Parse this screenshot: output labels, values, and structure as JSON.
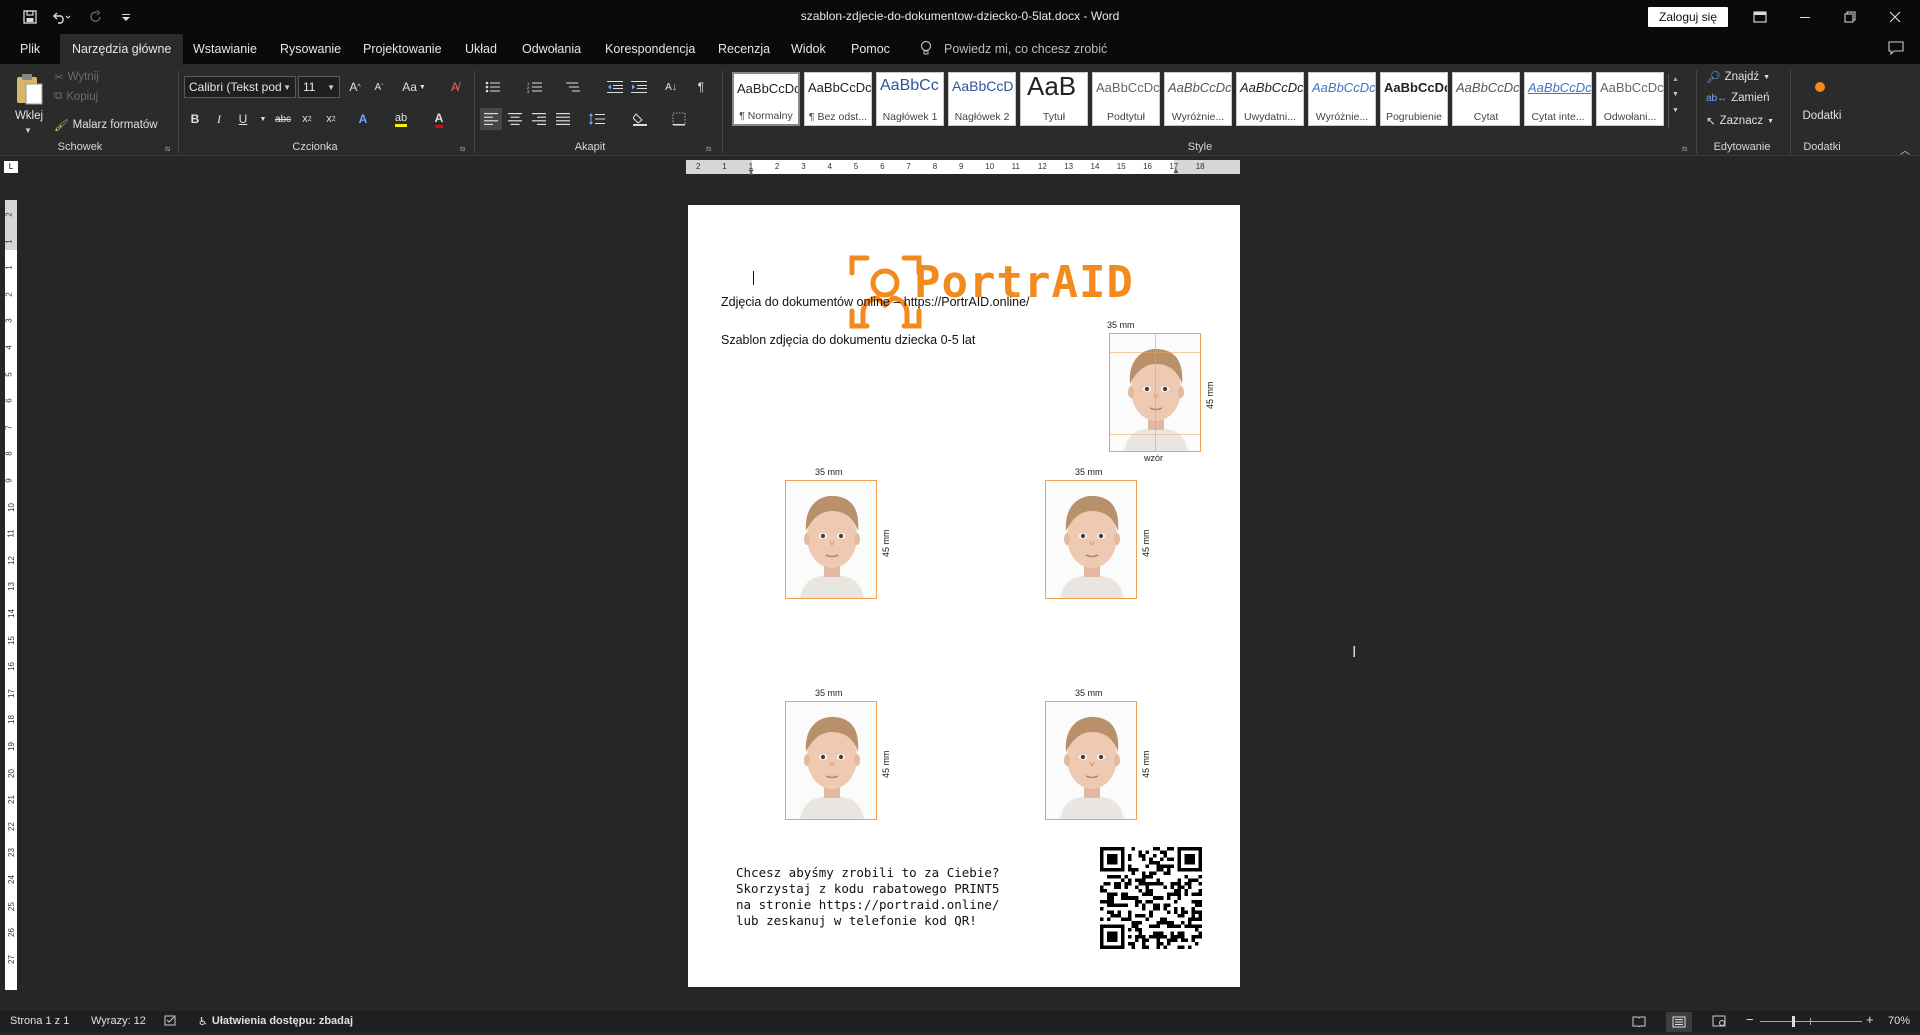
{
  "titlebar": {
    "doc_title": "szablon-zdjecie-do-dokumentow-dziecko-0-5lat.docx  -  Word",
    "signin_label": "Zaloguj się"
  },
  "menu": {
    "file": "Plik",
    "tabs": [
      "Narzędzia główne",
      "Wstawianie",
      "Rysowanie",
      "Projektowanie",
      "Układ",
      "Odwołania",
      "Korespondencja",
      "Recenzja",
      "Widok",
      "Pomoc"
    ],
    "tell_me": "Powiedz mi, co chcesz zrobić"
  },
  "ribbon": {
    "clipboard": {
      "paste_label": "Wklej",
      "cut_label": "Wytnij",
      "copy_label": "Kopiuj",
      "format_painter_label": "Malarz formatów",
      "group_label": "Schowek"
    },
    "font": {
      "font_name": "Calibri (Tekst pod",
      "font_size": "11",
      "case_label": "Aa",
      "group_label": "Czcionka"
    },
    "paragraph": {
      "group_label": "Akapit"
    },
    "styles": {
      "group_label": "Style",
      "items": [
        {
          "preview": "AaBbCcDc",
          "name": "¶ Normalny"
        },
        {
          "preview": "AaBbCcDc",
          "name": "¶ Bez odst..."
        },
        {
          "preview": "AaBbCc",
          "name": "Nagłówek 1"
        },
        {
          "preview": "AaBbCcD",
          "name": "Nagłówek 2"
        },
        {
          "preview": "AaB",
          "name": "Tytuł"
        },
        {
          "preview": "AaBbCcDc",
          "name": "Podtytuł"
        },
        {
          "preview": "AaBbCcDc",
          "name": "Wyróżnie..."
        },
        {
          "preview": "AaBbCcDc",
          "name": "Uwydatni..."
        },
        {
          "preview": "AaBbCcDc",
          "name": "Wyróżnie..."
        },
        {
          "preview": "AaBbCcDc",
          "name": "Pogrubienie"
        },
        {
          "preview": "AaBbCcDc",
          "name": "Cytat"
        },
        {
          "preview": "AaBbCcDc",
          "name": "Cytat inte..."
        },
        {
          "preview": "AaBbCcDc",
          "name": "Odwołani..."
        }
      ]
    },
    "editing": {
      "find_label": "Znajdź",
      "replace_label": "Zamień",
      "select_label": "Zaznacz",
      "group_label": "Edytowanie"
    },
    "addins": {
      "label": "Dodatki",
      "group_label": "Dodatki"
    }
  },
  "document": {
    "logo_text": "PortrAID",
    "line1": "Zdjęcia do dokumentów online – https://PortrAID.online/",
    "line2": "Szablon zdjęcia do dokumentu dziecka 0-5 lat",
    "width_label": "35 mm",
    "height_label": "45 mm",
    "sample_label": "wzór",
    "promo_lines": [
      "Chcesz abyśmy zrobili to za Ciebie?",
      "Skorzystaj z kodu rabatowego PRINT5",
      "na stronie https://portraid.online/",
      "lub zeskanuj w telefonie kod QR!"
    ]
  },
  "statusbar": {
    "page": "Strona 1 z 1",
    "words": "Wyrazy: 12",
    "accessibility": "Ułatwienia dostępu: zbadaj",
    "zoom": "70%"
  },
  "ruler": {
    "h_numbers": [
      "2",
      "1",
      "1",
      "2",
      "3",
      "4",
      "5",
      "6",
      "7",
      "8",
      "9",
      "10",
      "11",
      "12",
      "13",
      "14",
      "15",
      "16",
      "17",
      "18"
    ],
    "v_numbers": [
      "2",
      "1",
      "1",
      "2",
      "3",
      "4",
      "5",
      "6",
      "7",
      "8",
      "9",
      "10",
      "11",
      "12",
      "13",
      "14",
      "15",
      "16",
      "17",
      "18",
      "19",
      "20",
      "21",
      "22",
      "23",
      "24",
      "25",
      "26",
      "27"
    ]
  },
  "colors": {
    "brand_orange": "#f28a1e"
  }
}
